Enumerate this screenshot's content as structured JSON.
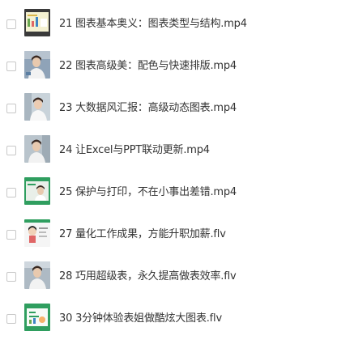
{
  "files": [
    {
      "name": "21 图表基本奥义：图表类型与结构.mp4",
      "thumb": "chart-slide-thumbnail"
    },
    {
      "name": "22 图表高级美：配色与快速排版.mp4",
      "thumb": "presenter-video-thumbnail"
    },
    {
      "name": "23 大数据风汇报：高级动态图表.mp4",
      "thumb": "presenter-video-thumbnail"
    },
    {
      "name": "24 让Excel与PPT联动更新.mp4",
      "thumb": "presenter-video-thumbnail"
    },
    {
      "name": "25 保护与打印，不在小事出差错.mp4",
      "thumb": "presenter-green-slide-thumbnail"
    },
    {
      "name": "27 量化工作成果，方能升职加薪.flv",
      "thumb": "cartoon-slide-thumbnail"
    },
    {
      "name": "28 巧用超级表，永久提高做表效率.flv",
      "thumb": "presenter-video-thumbnail"
    },
    {
      "name": "30 3分钟体验表姐做酷炫大图表.flv",
      "thumb": "green-title-slide-thumbnail"
    }
  ],
  "colors": {
    "text": "#333333",
    "checkbox_border": "#c8c8c8",
    "slide_green": "#2f9e5f"
  }
}
